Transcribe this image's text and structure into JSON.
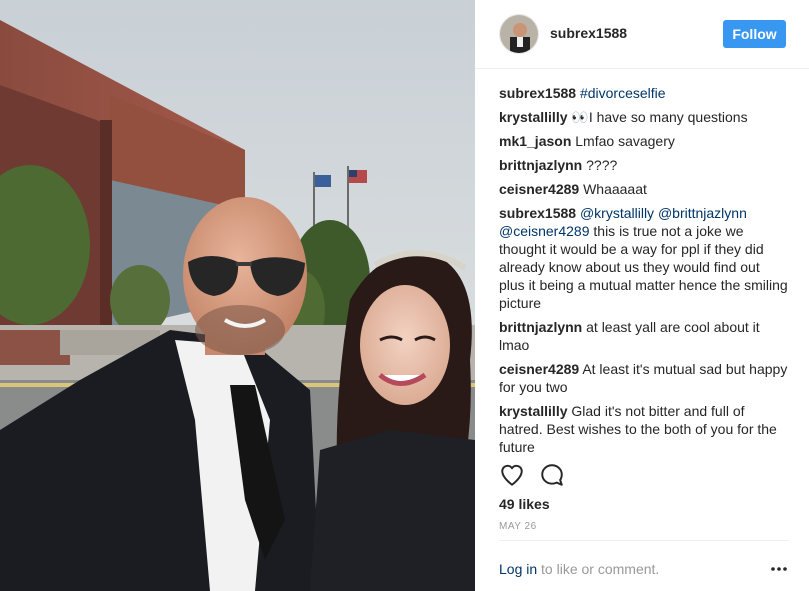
{
  "post": {
    "username": "subrex1588",
    "follow_label": "Follow",
    "likes": "49 likes",
    "date": "MAY 26"
  },
  "comments": [
    {
      "user": "subrex1588",
      "parts": [
        {
          "type": "link",
          "text": "#divorceselfie"
        }
      ]
    },
    {
      "user": "krystallilly",
      "parts": [
        {
          "type": "text",
          "text": "👀I have so many questions"
        }
      ]
    },
    {
      "user": "mk1_jason",
      "parts": [
        {
          "type": "text",
          "text": "Lmfao savagery"
        }
      ]
    },
    {
      "user": "brittnjazlynn",
      "parts": [
        {
          "type": "text",
          "text": "????"
        }
      ]
    },
    {
      "user": "ceisner4289",
      "parts": [
        {
          "type": "text",
          "text": "Whaaaaat"
        }
      ]
    },
    {
      "user": "subrex1588",
      "parts": [
        {
          "type": "link",
          "text": "@krystallilly"
        },
        {
          "type": "text",
          "text": " "
        },
        {
          "type": "link",
          "text": "@brittnjazlynn"
        },
        {
          "type": "text",
          "text": " "
        },
        {
          "type": "link",
          "text": "@ceisner4289"
        },
        {
          "type": "text",
          "text": " this is true not a joke we thought it would be a way for ppl if they did already know about us they would find out plus it being a mutual matter hence the smiling picture"
        }
      ]
    },
    {
      "user": "brittnjazlynn",
      "parts": [
        {
          "type": "text",
          "text": "at least yall are cool about it lmao"
        }
      ]
    },
    {
      "user": "ceisner4289",
      "parts": [
        {
          "type": "text",
          "text": "At least it's mutual sad but happy for you two"
        }
      ]
    },
    {
      "user": "krystallilly",
      "parts": [
        {
          "type": "text",
          "text": "Glad it's not bitter and full of hatred. Best wishes to the both of you for the future"
        }
      ]
    }
  ],
  "footer": {
    "login_label": "Log in",
    "login_suffix": " to like or comment."
  },
  "icons": {
    "like": "heart-outline-icon",
    "comment": "speech-bubble-icon",
    "more": "more-options-icon"
  },
  "colors": {
    "follow_button": "#3897f0",
    "link": "#003569",
    "muted": "#999999"
  }
}
